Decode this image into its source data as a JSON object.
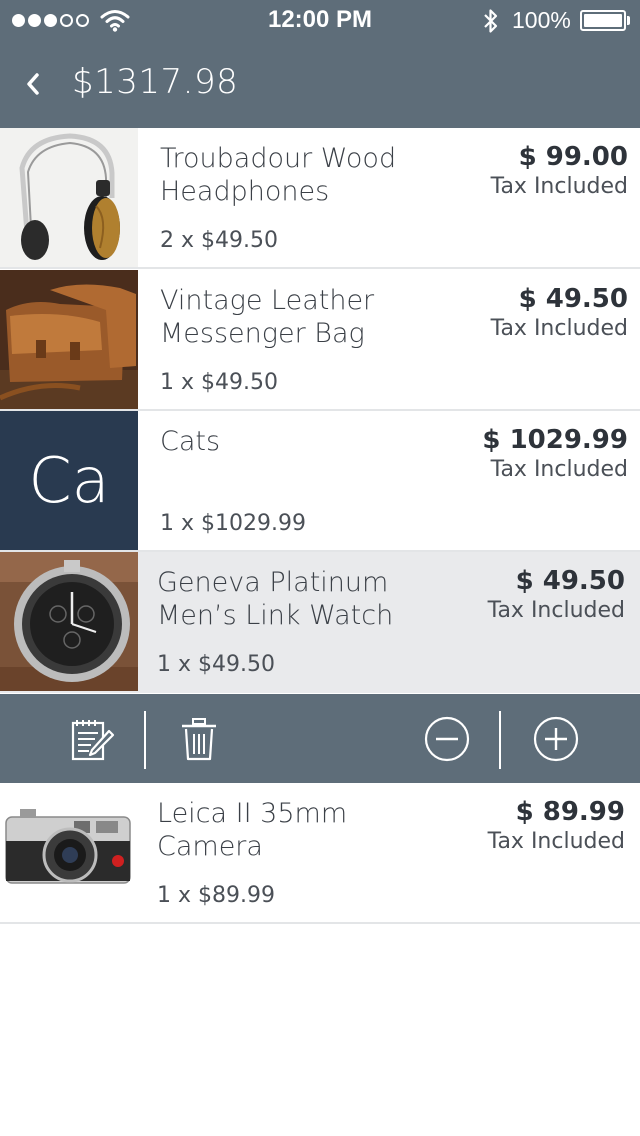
{
  "status_bar": {
    "time": "12:00 PM",
    "battery_percent": "100%",
    "signal_bars_filled": 3,
    "signal_bars_total": 5
  },
  "nav": {
    "back_icon": "chevron-left-icon",
    "title": "$1317.98"
  },
  "cart_items": [
    {
      "name": "Troubadour Wood Headphones",
      "quantity_line": "2 x $49.50",
      "price": "$ 99.00",
      "tax_note": "Tax Included",
      "thumb": "headphones-image"
    },
    {
      "name": "Vintage Leather Messenger Bag",
      "quantity_line": "1 x $49.50",
      "price": "$ 49.50",
      "tax_note": "Tax Included",
      "thumb": "messenger-bag-image"
    },
    {
      "name": "Cats",
      "quantity_line": "1 x $1029.99",
      "price": "$ 1029.99",
      "tax_note": "Tax Included",
      "thumb_initials": "Ca"
    },
    {
      "name": "Geneva Platinum Men’s Link Watch",
      "quantity_line": "1 x $49.50",
      "price": "$ 49.50",
      "tax_note": "Tax Included",
      "thumb": "watch-image",
      "selected": true
    },
    {
      "name": "Leica II 35mm Camera",
      "quantity_line": "1 x $89.99",
      "price": "$ 89.99",
      "tax_note": "Tax Included",
      "thumb": "camera-image"
    }
  ],
  "item_actions": {
    "icons": [
      "edit-note-icon",
      "trash-icon",
      "minus-circle-icon",
      "plus-circle-icon"
    ]
  },
  "colors": {
    "bar": "#5e6d79",
    "initials_tile": "#293a50",
    "selected_row": "#e9eaec"
  }
}
